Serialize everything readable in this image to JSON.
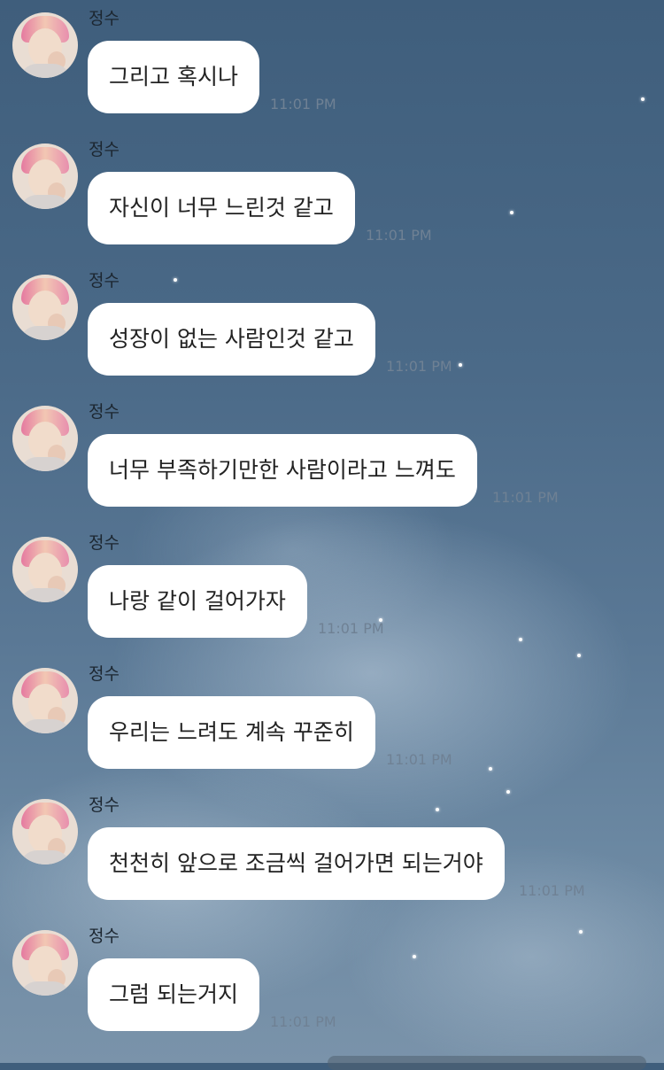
{
  "messages": [
    {
      "sender": "정수",
      "text": "그리고 혹시나",
      "time": "11:01 PM"
    },
    {
      "sender": "정수",
      "text": "자신이 너무 느린것 같고",
      "time": "11:01 PM"
    },
    {
      "sender": "정수",
      "text": "성장이 없는 사람인것 같고",
      "time": "11:01 PM"
    },
    {
      "sender": "정수",
      "text": "너무 부족하기만한 사람이라고 느껴도",
      "time": "11:01 PM"
    },
    {
      "sender": "정수",
      "text": "나랑 같이 걸어가자",
      "time": "11:01 PM"
    },
    {
      "sender": "정수",
      "text": "우리는 느려도 계속 꾸준히",
      "time": "11:01 PM"
    },
    {
      "sender": "정수",
      "text": "천천히 앞으로 조금씩 걸어가면 되는거야",
      "time": "11:01 PM"
    },
    {
      "sender": "정수",
      "text": "그럼 되는거지",
      "time": "11:01 PM"
    }
  ],
  "colors": {
    "bubble": "#ffffff",
    "message_text": "#222222",
    "timestamp": "#6f8194",
    "sender_name": "#1c2630"
  }
}
